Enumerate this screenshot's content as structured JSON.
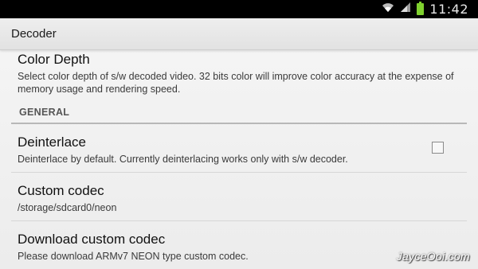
{
  "status_bar": {
    "time": "11:42",
    "icons": [
      "wifi-icon",
      "signal-icon",
      "battery-icon"
    ],
    "battery_color": "#7fd12e"
  },
  "action_bar": {
    "title": "Decoder"
  },
  "preferences": {
    "color_depth": {
      "title": "Color Depth",
      "summary": "Select color depth of s/w decoded video. 32 bits color will improve color accuracy at the expense of memory usage and rendering speed."
    },
    "section_general": "GENERAL",
    "deinterlace": {
      "title": "Deinterlace",
      "summary": "Deinterlace by default. Currently deinterlacing works only with s/w decoder.",
      "checked": false
    },
    "custom_codec": {
      "title": "Custom codec",
      "summary": "/storage/sdcard0/neon"
    },
    "download_codec": {
      "title": "Download custom codec",
      "summary": "Please download ARMv7 NEON type custom codec."
    }
  },
  "watermark": "JayceOoi.com"
}
